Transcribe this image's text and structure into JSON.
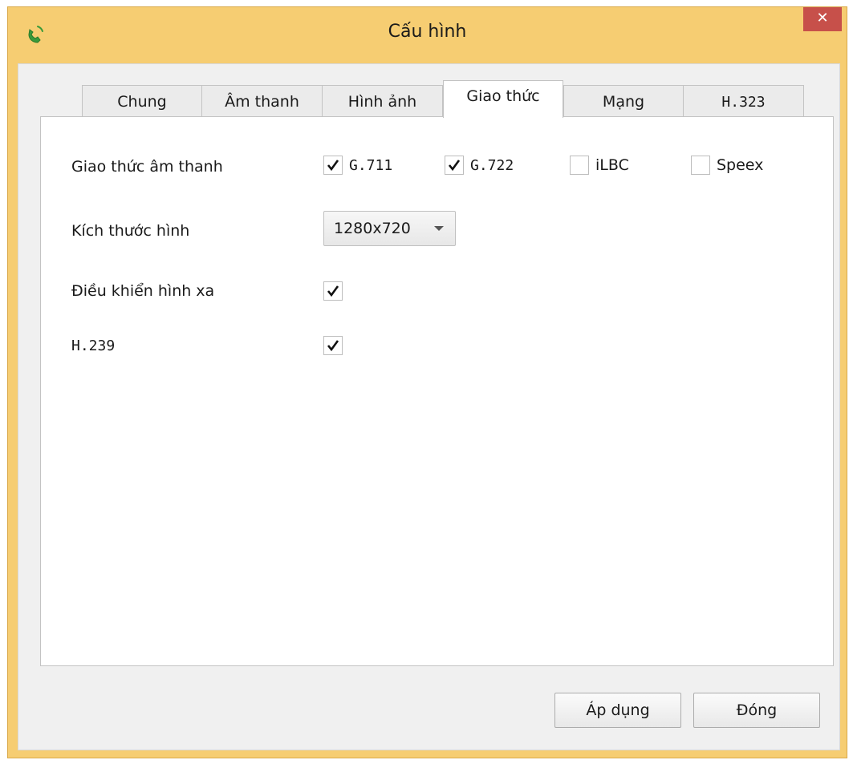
{
  "window": {
    "title": "Cấu hình",
    "close_label": "✕",
    "icon": "phone-icon"
  },
  "tabs": [
    {
      "label": "Chung",
      "active": false
    },
    {
      "label": "Âm thanh",
      "active": false
    },
    {
      "label": "Hình ảnh",
      "active": false
    },
    {
      "label": "Giao thức",
      "active": true
    },
    {
      "label": "Mạng",
      "active": false
    },
    {
      "label": "H.323",
      "active": false
    }
  ],
  "settings": {
    "audio_protocol": {
      "label": "Giao thức âm thanh",
      "codecs": [
        {
          "label": "G.711",
          "checked": true
        },
        {
          "label": "G.722",
          "checked": true
        },
        {
          "label": "iLBC",
          "checked": false
        },
        {
          "label": "Speex",
          "checked": false
        }
      ]
    },
    "video_size": {
      "label": "Kích thước hình",
      "value": "1280x720"
    },
    "far_end_camera_control": {
      "label": "Điều khiển hình xa",
      "checked": true
    },
    "h239": {
      "label": "H.239",
      "checked": true
    }
  },
  "buttons": {
    "apply_label": "Áp dụng",
    "close_label": "Đóng"
  },
  "colors": {
    "title_bar": "#f6cd72",
    "close_button": "#c7504a",
    "phone_icon": "#3a9a3a"
  }
}
